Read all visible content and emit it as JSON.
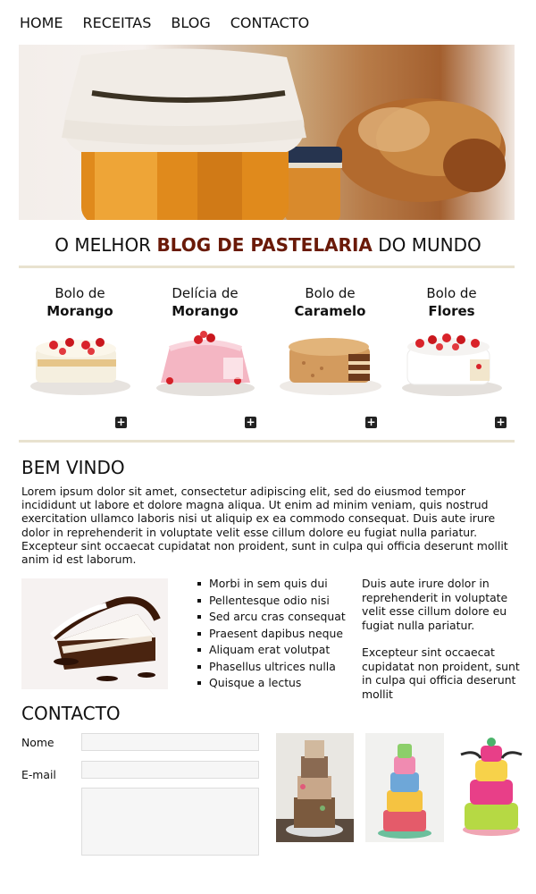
{
  "nav": {
    "items": [
      "HOME",
      "RECEITAS",
      "BLOG",
      "CONTACTO"
    ]
  },
  "tagline": {
    "before": "O MELHOR ",
    "highlight": "BLOG DE PASTELARIA",
    "after": " DO MUNDO"
  },
  "products": [
    {
      "line1": "Bolo de",
      "line2": "Morango"
    },
    {
      "line1": "Delícia de",
      "line2": "Morango"
    },
    {
      "line1": "Bolo de",
      "line2": "Caramelo"
    },
    {
      "line1": "Bolo de",
      "line2": "Flores"
    }
  ],
  "icons": {
    "more": "plus-icon"
  },
  "welcome": {
    "title": "BEM VINDO",
    "text": "Lorem ipsum dolor sit amet, consectetur adipiscing elit, sed do eiusmod tempor incididunt ut labore et dolore magna aliqua. Ut enim ad minim veniam, quis nostrud exercitation ullamco laboris nisi ut aliquip ex ea commodo consequat. Duis aute irure dolor in reprehenderit in voluptate velit esse cillum dolore eu fugiat nulla pariatur. Excepteur sint occaecat cupidatat non proident, sunt in culpa qui officia deserunt mollit anim id est laborum."
  },
  "features": {
    "list": [
      "Morbi in sem quis dui",
      "Pellentesque odio nisi",
      "Sed arcu cras consequat",
      "Praesent dapibus neque",
      "Aliquam erat volutpat",
      "Phasellus ultrices nulla",
      "Quisque a lectus"
    ],
    "side_p1": "Duis aute irure dolor in reprehenderit in voluptate velit esse cillum dolore eu fugiat nulla pariatur.",
    "side_p2": "Excepteur sint occaecat cupidatat non proident, sunt in culpa qui officia deserunt mollit"
  },
  "contact": {
    "title": "CONTACTO",
    "name_label": "Nome",
    "email_label": "E-mail",
    "name_value": "",
    "email_value": "",
    "message_value": ""
  },
  "colors": {
    "accent": "#6a1a08",
    "rule": "#e8e2cf"
  }
}
